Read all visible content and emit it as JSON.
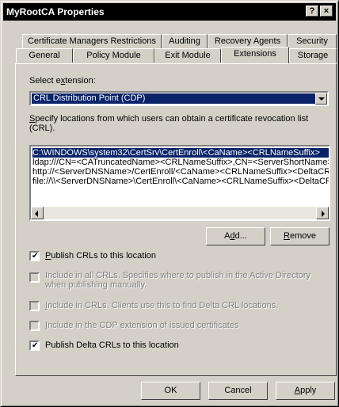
{
  "window": {
    "title": "MyRootCA Properties",
    "help_glyph": "?",
    "close_glyph": "×"
  },
  "tabs": {
    "row1": [
      "Certificate Managers Restrictions",
      "Auditing",
      "Recovery Agents",
      "Security"
    ],
    "row2": [
      "General",
      "Policy Module",
      "Exit Module",
      "Extensions",
      "Storage"
    ],
    "active": "Extensions"
  },
  "extensions": {
    "select_label_pre": "Select e",
    "select_label_mn": "x",
    "select_label_post": "tension:",
    "selected_extension": "CRL Distribution Point (CDP)",
    "locations_label_mn": "S",
    "locations_label_post": "pecify locations from which users can obtain a certificate revocation list",
    "locations_label_line2": "(CRL).",
    "locations": [
      "C:\\WINDOWS\\system32\\CertSrv\\CertEnroll\\<CaName><CRLNameSuffix>",
      "ldap:///CN=<CATruncatedName><CRLNameSuffix>,CN=<ServerShortName>",
      "http://<ServerDNSName>/CertEnroll/<CaName><CRLNameSuffix><DeltaCRLAllowed>.crl",
      "file://\\\\<ServerDNSName>\\CertEnroll\\<CaName><CRLNameSuffix><DeltaCRLAllowed>.crl"
    ],
    "selected_location_index": 0,
    "add_button": {
      "pre": "A",
      "mn": "d",
      "post": "d..."
    },
    "remove_button": {
      "mn": "R",
      "post": "emove"
    }
  },
  "options": [
    {
      "mn": "P",
      "rest": "ublish CRLs to this location",
      "line2": "",
      "checked": true,
      "enabled": true
    },
    {
      "mn": "",
      "rest": "Include in all CRLs. Specifies where to publish in the Active Directory",
      "line2": "when publishing manually.",
      "checked": false,
      "enabled": false
    },
    {
      "mn": "I",
      "rest": "nclude in CRLs. Clients use this to find Delta CRL locations.",
      "line2": "",
      "checked": false,
      "enabled": false
    },
    {
      "mn": "I",
      "rest": "nclude in the CDP extension of issued certificates",
      "line2": "",
      "checked": false,
      "enabled": false
    },
    {
      "mn": "",
      "rest": "Publish Delta CRLs to this location",
      "line2": "",
      "checked": true,
      "enabled": true
    }
  ],
  "footer": {
    "ok": "OK",
    "cancel": "Cancel",
    "apply_mn": "A",
    "apply_post": "pply"
  },
  "check_glyph": "✔"
}
